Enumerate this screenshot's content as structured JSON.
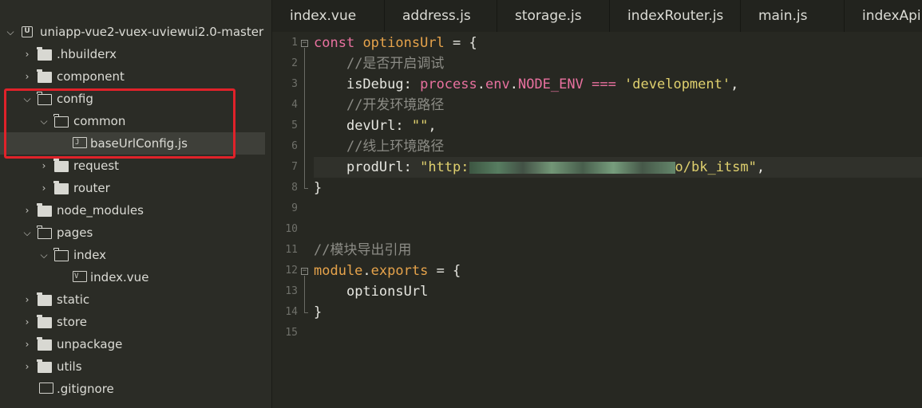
{
  "sidebar": {
    "items": [
      {
        "label": "uniapp-vue2-vuex-uviewui2.0-master",
        "type": "project",
        "level": 0,
        "state": "expanded"
      },
      {
        "label": ".hbuilderx",
        "type": "folder",
        "level": 1,
        "state": "collapsed"
      },
      {
        "label": "component",
        "type": "folder",
        "level": 1,
        "state": "collapsed"
      },
      {
        "label": "config",
        "type": "folder",
        "level": 1,
        "state": "expanded"
      },
      {
        "label": "common",
        "type": "folder",
        "level": 2,
        "state": "expanded"
      },
      {
        "label": "baseUrlConfig.js",
        "type": "file-js",
        "level": 3,
        "state": "selected"
      },
      {
        "label": "request",
        "type": "folder",
        "level": 2,
        "state": "collapsed"
      },
      {
        "label": "router",
        "type": "folder",
        "level": 2,
        "state": "collapsed"
      },
      {
        "label": "node_modules",
        "type": "folder",
        "level": 1,
        "state": "collapsed"
      },
      {
        "label": "pages",
        "type": "folder",
        "level": 1,
        "state": "expanded"
      },
      {
        "label": "index",
        "type": "folder",
        "level": 2,
        "state": "expanded"
      },
      {
        "label": "index.vue",
        "type": "file-vue",
        "level": 3,
        "state": "none"
      },
      {
        "label": "static",
        "type": "folder",
        "level": 1,
        "state": "collapsed"
      },
      {
        "label": "store",
        "type": "folder",
        "level": 1,
        "state": "collapsed"
      },
      {
        "label": "unpackage",
        "type": "folder",
        "level": 1,
        "state": "collapsed"
      },
      {
        "label": "utils",
        "type": "folder",
        "level": 1,
        "state": "collapsed"
      },
      {
        "label": ".gitignore",
        "type": "file",
        "level": 1,
        "state": "none"
      }
    ]
  },
  "tabs": [
    {
      "label": "index.vue"
    },
    {
      "label": "address.js"
    },
    {
      "label": "storage.js"
    },
    {
      "label": "indexRouter.js"
    },
    {
      "label": "main.js"
    },
    {
      "label": "indexApi.js"
    }
  ],
  "editor": {
    "line_numbers": [
      "1",
      "2",
      "3",
      "4",
      "5",
      "6",
      "7",
      "8",
      "9",
      "10",
      "11",
      "12",
      "13",
      "14",
      "15"
    ],
    "current_line": 7,
    "code": {
      "l1_kw": "const",
      "l1_var": "optionsUrl",
      "l1_rest": " = {",
      "l2_comment": "//是否开启调试",
      "l3_key": "isDebug",
      "l3_colon": ": ",
      "l3_process": "process",
      "l3_dot1": ".",
      "l3_env": "env",
      "l3_dot2": ".",
      "l3_node_env": "NODE_ENV",
      "l3_op": " === ",
      "l3_str": "'development'",
      "l3_end": ",",
      "l4_comment": "//开发环境路径",
      "l5_key": "devUrl",
      "l5_colon": ": ",
      "l5_str": "\"\"",
      "l5_end": ",",
      "l6_comment": "//线上环境路径",
      "l7_key": "prodUrl",
      "l7_colon": ": ",
      "l7_str_start": "\"http:",
      "l7_str_end": "o/bk_itsm\"",
      "l7_end": ",",
      "l8": "}",
      "l11_comment": "//模块导出引用",
      "l12_module": "module",
      "l12_dot": ".",
      "l12_exports": "exports",
      "l12_rest": " = {",
      "l13": "optionsUrl",
      "l14": "}"
    }
  }
}
